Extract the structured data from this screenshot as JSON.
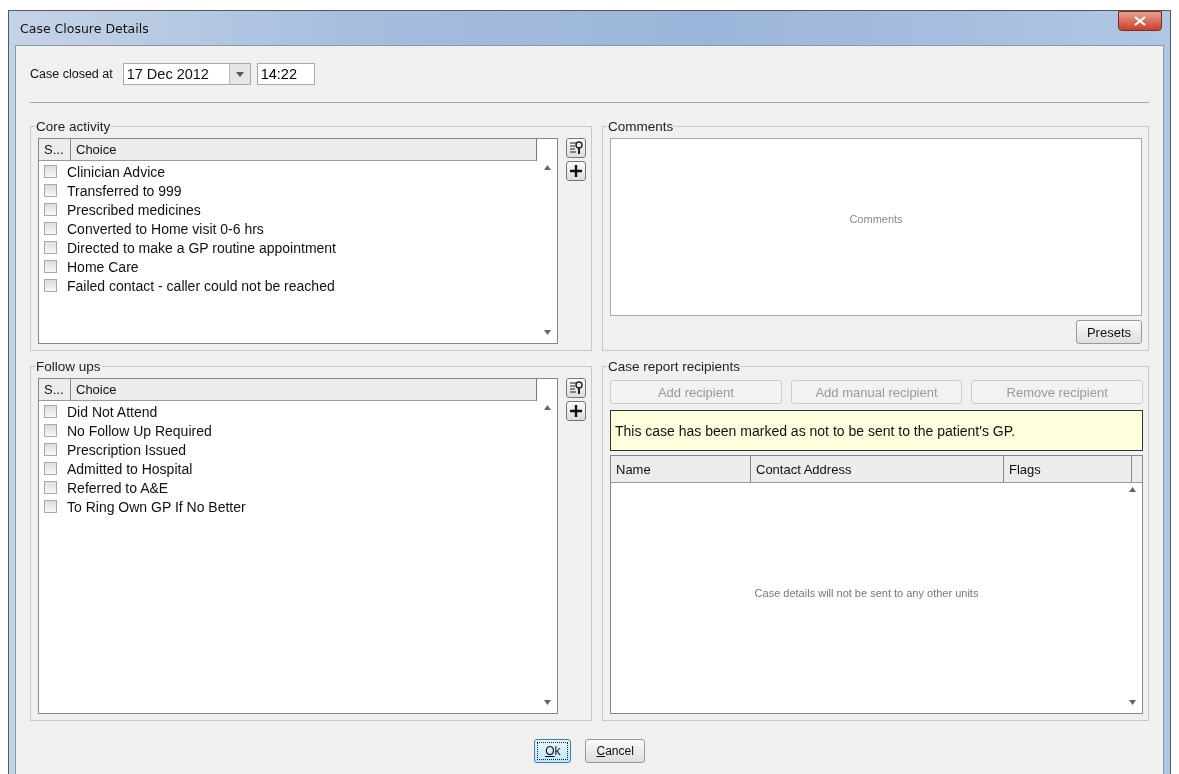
{
  "window": {
    "title": "Case Closure Details"
  },
  "closed_at": {
    "label": "Case closed at",
    "date": "17 Dec 2012",
    "time": "14:22"
  },
  "core_activity": {
    "title": "Core activity",
    "columns": [
      "S...",
      "Choice"
    ],
    "items": [
      {
        "label": "Clinician Advice",
        "checked": false
      },
      {
        "label": "Transferred to 999",
        "checked": false
      },
      {
        "label": "Prescribed medicines",
        "checked": false
      },
      {
        "label": "Converted to Home visit 0-6 hrs",
        "checked": false
      },
      {
        "label": "Directed to make a GP routine appointment",
        "checked": false
      },
      {
        "label": "Home Care",
        "checked": false
      },
      {
        "label": "Failed contact - caller could not be reached",
        "checked": false
      }
    ]
  },
  "follow_ups": {
    "title": "Follow ups",
    "columns": [
      "S...",
      "Choice"
    ],
    "items": [
      {
        "label": "Did Not Attend",
        "checked": false
      },
      {
        "label": "No Follow Up Required",
        "checked": false
      },
      {
        "label": "Prescription Issued",
        "checked": false
      },
      {
        "label": "Admitted to Hospital",
        "checked": false
      },
      {
        "label": "Referred to A&E",
        "checked": false
      },
      {
        "label": "To Ring Own GP If No Better",
        "checked": false
      }
    ]
  },
  "comments": {
    "title": "Comments",
    "placeholder": "Comments",
    "presets_button": "Presets"
  },
  "recipients": {
    "title": "Case report recipients",
    "buttons": [
      {
        "label": "Add recipient",
        "disabled": true
      },
      {
        "label": "Add manual recipient",
        "disabled": true
      },
      {
        "label": "Remove recipient",
        "disabled": true
      }
    ],
    "notice": "This case has been marked as not to be sent to the patient's GP.",
    "columns": [
      "Name",
      "Contact Address",
      "Flags"
    ],
    "empty_message": "Case details will not be sent to any other units"
  },
  "buttons": [
    {
      "label": "Ok",
      "default": true
    },
    {
      "label": "Cancel",
      "default": false
    }
  ]
}
